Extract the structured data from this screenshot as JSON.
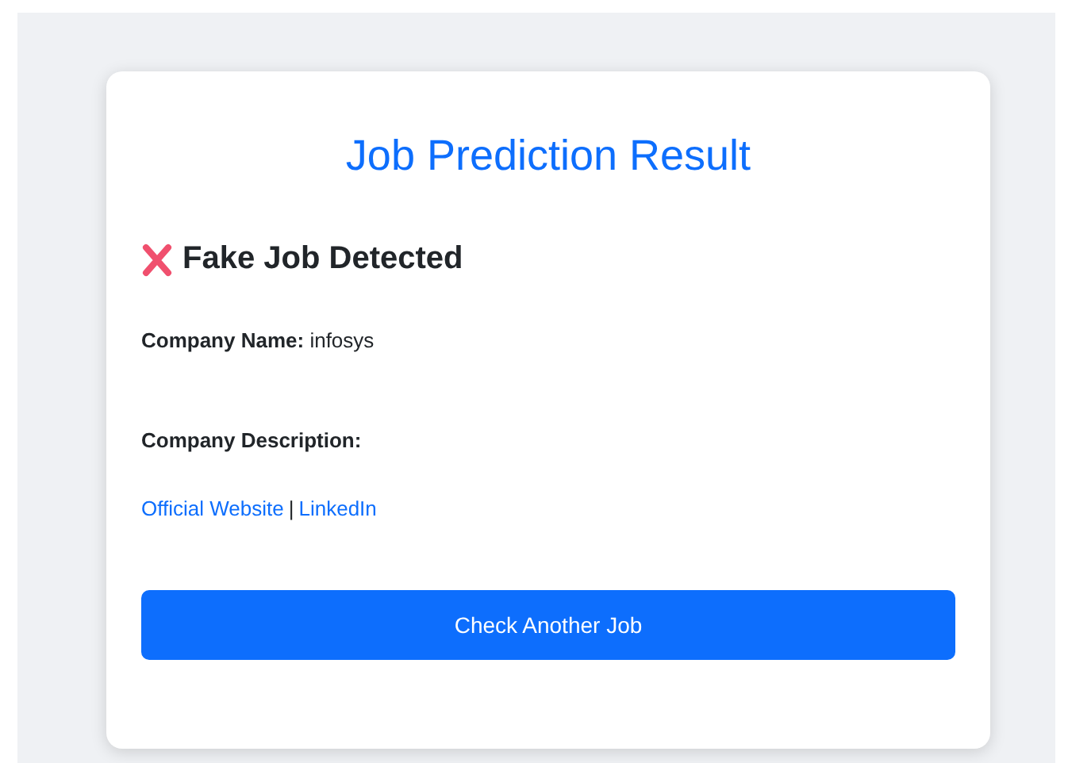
{
  "title": "Job Prediction Result",
  "result": {
    "kind": "fake",
    "text": "Fake Job Detected"
  },
  "company_name": {
    "label": "Company Name:",
    "value": "infosys"
  },
  "company_description": {
    "label": "Company Description:"
  },
  "links": [
    {
      "text": "Official Website"
    },
    {
      "text": "LinkedIn"
    }
  ],
  "link_separator": "|",
  "button": "Check Another Job"
}
